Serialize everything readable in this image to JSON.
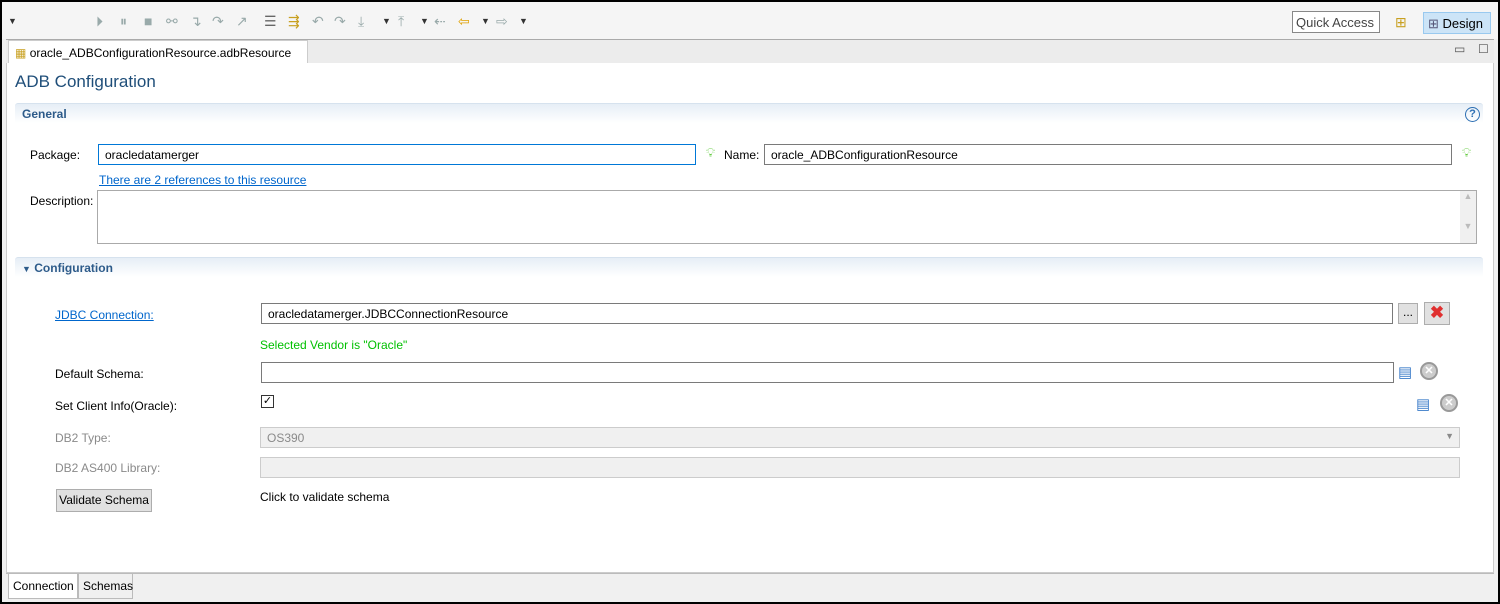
{
  "toolbar": {
    "quick_access": "Quick Access",
    "design_label": "Design"
  },
  "editor_tab": {
    "label": "oracle_ADBConfigurationResource.adbResource"
  },
  "page_title": "ADB Configuration",
  "general": {
    "header": "General",
    "package_label": "Package:",
    "package_value": "oracledatamerger",
    "name_label": "Name:",
    "name_value": "oracle_ADBConfigurationResource",
    "references_link": "There are 2 references to this resource",
    "description_label": "Description:",
    "description_value": ""
  },
  "configuration": {
    "header": "Configuration",
    "jdbc_label": "JDBC Connection:",
    "jdbc_value": "oracledatamerger.JDBCConnectionResource",
    "browse_label": "...",
    "vendor_status": "Selected Vendor is \"Oracle\"",
    "vendor_color": "#00c000",
    "schema_label": "Default Schema:",
    "schema_value": "",
    "client_info_label": "Set Client Info(Oracle):",
    "client_info_checked": true,
    "db2_type_label": "DB2 Type:",
    "db2_type_value": "OS390",
    "as400_label": "DB2 AS400 Library:",
    "as400_value": "",
    "validate_button": "Validate Schema",
    "validate_hint": "Click to validate schema"
  },
  "bottom_tabs": [
    {
      "label": "Connection"
    },
    {
      "label": "Schemas"
    }
  ]
}
